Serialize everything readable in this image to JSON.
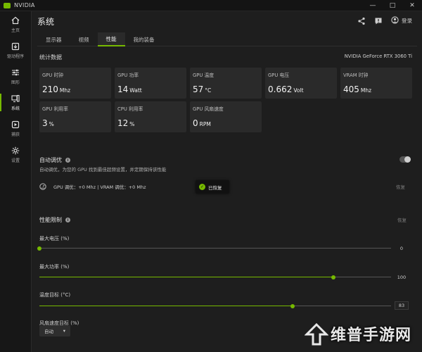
{
  "window": {
    "title": "NVIDIA",
    "controls": [
      "—",
      "□",
      "✕"
    ]
  },
  "sidebar": {
    "items": [
      {
        "label": "主页",
        "icon": "home-icon"
      },
      {
        "label": "驱动程序",
        "icon": "driver-icon"
      },
      {
        "label": "图形",
        "icon": "graphics-sliders-icon"
      },
      {
        "label": "系统",
        "icon": "system-icon",
        "active": true
      },
      {
        "label": "捕获",
        "icon": "capture-icon"
      },
      {
        "label": "设置",
        "icon": "gear-icon"
      }
    ]
  },
  "header": {
    "title": "系统",
    "login_label": "登录"
  },
  "tabs": [
    {
      "label": "显示器"
    },
    {
      "label": "视频"
    },
    {
      "label": "性能",
      "active": true
    },
    {
      "label": "我的装备"
    }
  ],
  "stats": {
    "title": "统计数据",
    "gpu_name": "NVIDIA GeForce RTX 3060 Ti",
    "cards": [
      {
        "label": "GPU 时钟",
        "value": "210",
        "unit": "Mhz"
      },
      {
        "label": "GPU 功率",
        "value": "14",
        "unit": "Watt"
      },
      {
        "label": "GPU 温度",
        "value": "57",
        "unit": "°C"
      },
      {
        "label": "GPU 电压",
        "value": "0.662",
        "unit": "Volt"
      },
      {
        "label": "VRAM 时钟",
        "value": "405",
        "unit": "Mhz"
      },
      {
        "label": "GPU 利用率",
        "value": "3",
        "unit": "%"
      },
      {
        "label": "CPU 利用率",
        "value": "12",
        "unit": "%"
      },
      {
        "label": "GPU 风扇速度",
        "value": "0",
        "unit": "RPM"
      }
    ]
  },
  "auto_tune": {
    "title": "自动调优",
    "description": "自动调优，为您的 GPU 找到最佳超频设置，并定期保持该性能",
    "enabled": false,
    "status_text": "GPU 调优：+0 Mhz  |  VRAM 调优：+0 Mhz",
    "reset_label": "恢复",
    "toast": "已恢复"
  },
  "perf_limits": {
    "title": "性能限制",
    "reset_label": "恢复",
    "sliders": [
      {
        "label": "最大电压 (%)",
        "value": "0",
        "fraction": 0.0
      },
      {
        "label": "最大功率 (%)",
        "value": "100",
        "fraction": 0.835
      },
      {
        "label": "温度目标 (°C)",
        "value": "83",
        "fraction": 0.72
      }
    ],
    "fan": {
      "label": "风扇速度目标 (%)",
      "dropdown_value": "自动"
    }
  },
  "watermark": {
    "text": "维普手游网"
  },
  "colors": {
    "accent": "#76b900",
    "background": "#1e1e1e",
    "card": "#2a2a2a"
  }
}
